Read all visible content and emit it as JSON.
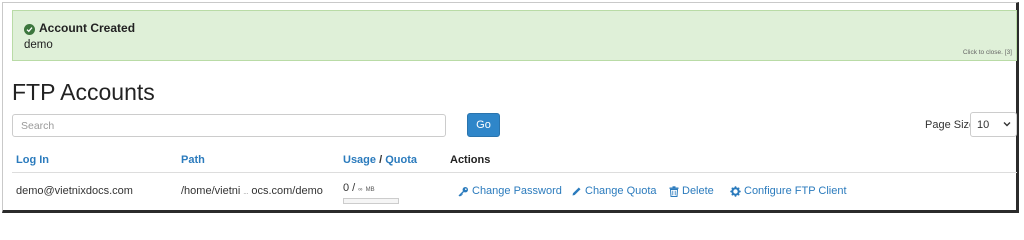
{
  "alert": {
    "title": "Account Created",
    "message": "demo",
    "close_text": "Click to close. [3]",
    "background": "#dff0d8"
  },
  "page_title": "FTP Accounts",
  "search": {
    "placeholder": "Search",
    "value": ""
  },
  "go_button": {
    "label": "Go",
    "color": "#2f86c9"
  },
  "page_size": {
    "label": "Page Size",
    "value": "10"
  },
  "table": {
    "columns": {
      "login": "Log In",
      "path": "Path",
      "usage": "Usage",
      "separator": " / ",
      "quota": "Quota",
      "actions": "Actions"
    },
    "rows": [
      {
        "login": "demo@vietnixdocs.com",
        "path": "/home/vietni",
        "path_end": "ocs.com/demo",
        "usage_value": "0 /",
        "usage_limit": "∞",
        "usage_unit": "MB",
        "usage_fraction": 0,
        "actions": {
          "change_password": "Change Password",
          "change_quota": "Change Quota",
          "delete": "Delete",
          "configure": "Configure FTP Client"
        }
      }
    ]
  },
  "icons": {
    "alert": "check-circle-icon",
    "change_password": "key-icon",
    "change_quota": "pencil-icon",
    "delete": "trash-icon",
    "configure": "gear-icon"
  },
  "colors": {
    "link": "#2b7bbd",
    "success": "#3c763d"
  }
}
